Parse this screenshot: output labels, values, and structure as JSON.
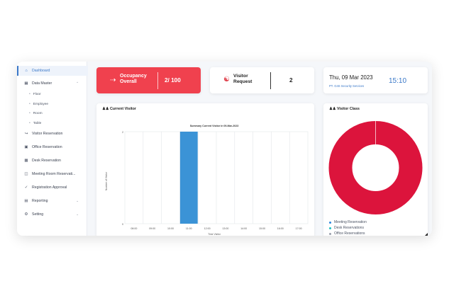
{
  "sidebar": {
    "items": [
      {
        "icon": "home-icon",
        "label": "Dashboard",
        "active": true
      },
      {
        "icon": "grid-icon",
        "label": "Data Master",
        "expanded": true,
        "children": [
          {
            "label": "Floor"
          },
          {
            "label": "Employee"
          },
          {
            "label": "Room"
          },
          {
            "label": "Table"
          }
        ]
      },
      {
        "icon": "login-icon",
        "label": "Visitor Reservation"
      },
      {
        "icon": "office-icon",
        "label": "Office Reservation"
      },
      {
        "icon": "desk-icon",
        "label": "Desk Reservation"
      },
      {
        "icon": "meeting-room-icon",
        "label": "Meeting Room Reservati..."
      },
      {
        "icon": "approval-icon",
        "label": "Registration Approval"
      },
      {
        "icon": "report-icon",
        "label": "Reporting",
        "has_chevron": true
      },
      {
        "icon": "gear-icon",
        "label": "Setting",
        "has_chevron": true
      }
    ]
  },
  "cards": {
    "occupancy": {
      "label_line1": "Occupancy",
      "label_line2": "Overall",
      "value": "2/ 100",
      "color": "#f0414e"
    },
    "visitor_request": {
      "label_line1": "Visitor",
      "label_line2": "Request",
      "value": "2"
    },
    "datetime": {
      "date": "Thu, 09 Mar 2023",
      "company": "PT. G4S Security Services",
      "time": "15:10"
    }
  },
  "current_visitor": {
    "title": "Current Visitor",
    "chart_title": "Summary Current Visitor in 09-Mar-2023",
    "ylabel": "Number of Visitor",
    "xlabel": "Time Visitor",
    "ytick_top": "2",
    "ytick_bottom": "0"
  },
  "visitor_class": {
    "title": "Visitor Class",
    "legend": [
      {
        "label": "Meeting Reservation",
        "color": "#2e86de"
      },
      {
        "label": "Desk Reservations",
        "color": "#1bc1c1"
      },
      {
        "label": "Office Reservations",
        "color": "#9aa0ad"
      }
    ]
  },
  "chart_data": [
    {
      "type": "bar",
      "title": "Summary Current Visitor in 09-Mar-2023",
      "xlabel": "Time Visitor",
      "ylabel": "Number of Visitor",
      "categories": [
        "08:00",
        "09:00",
        "10:00",
        "11:00",
        "12:00",
        "13:00",
        "14:00",
        "15:00",
        "16:00",
        "17:00"
      ],
      "values": [
        0,
        0,
        0,
        2,
        0,
        0,
        0,
        0,
        0,
        0
      ],
      "ylim": [
        0,
        2
      ],
      "grid": true,
      "color": "#3b93d6"
    },
    {
      "type": "pie",
      "donut": true,
      "labels": [
        "Meeting Reservation",
        "Desk Reservations",
        "Office Reservations"
      ],
      "values": [
        100,
        0,
        0
      ],
      "colors": [
        "#dc143c",
        "#1bc1c1",
        "#9aa0ad"
      ]
    }
  ]
}
